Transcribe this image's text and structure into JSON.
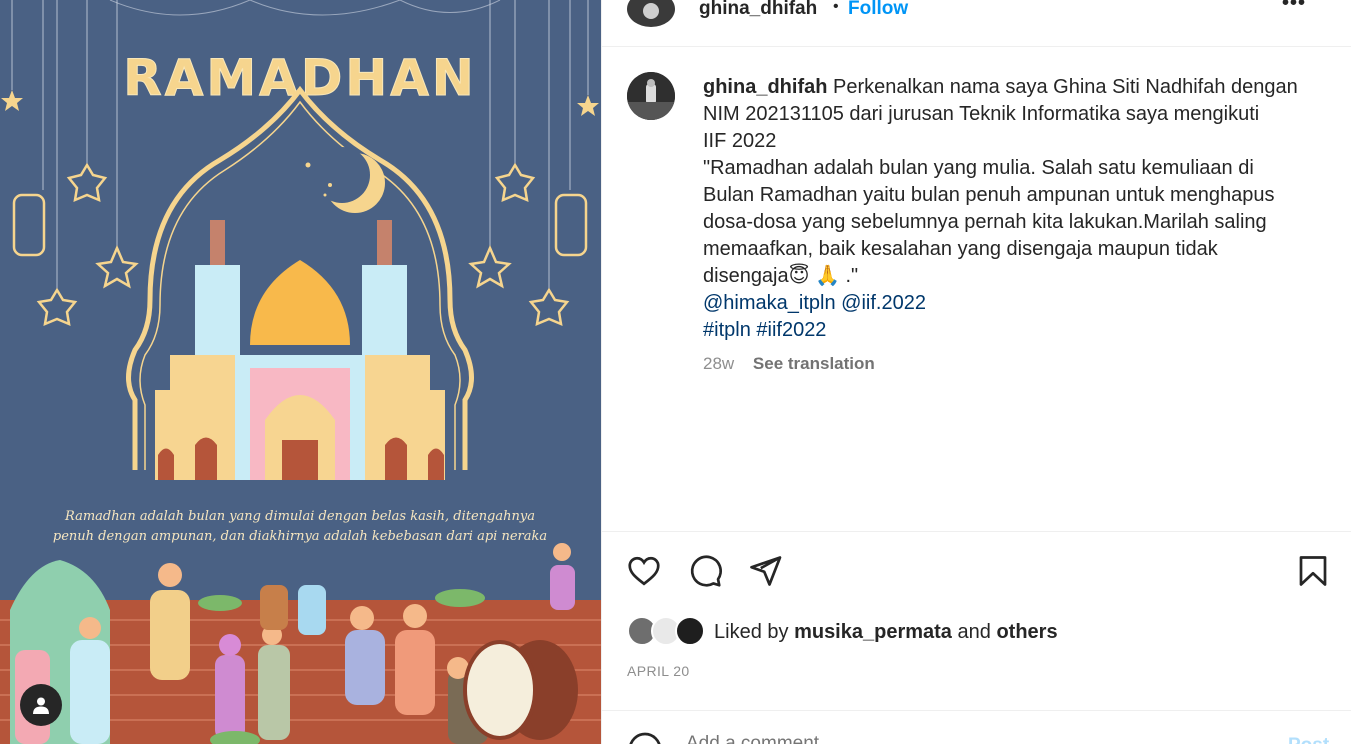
{
  "post": {
    "username": "ghina_dhifah",
    "follow_label": "Follow",
    "separator": "•",
    "more_label": "•••",
    "caption": {
      "line1": "Perkenalkan nama saya Ghina Siti Nadhifah dengan",
      "line2": "NIM 202131105 dari jurusan Teknik Informatika saya mengikuti",
      "line3": "IIF 2022",
      "line4": "\"Ramadhan adalah bulan yang mulia. Salah satu kemuliaan di",
      "line5": "Bulan Ramadhan yaitu bulan penuh ampunan untuk menghapus",
      "line6": "dosa-dosa yang sebelumnya pernah kita lakukan.Marilah saling",
      "line7": "memaafkan, baik kesalahan yang disengaja maupun tidak",
      "line8": "disengaja😇 🙏 .\"",
      "mention1": "@himaka_itpln",
      "mention2": "@iif.2022",
      "hashtag1": "#itpln",
      "hashtag2": "#iif2022"
    },
    "age": "28w",
    "see_translation": "See translation",
    "liked_prefix": "Liked by",
    "liked_user": "musika_permata",
    "liked_and": "and",
    "liked_others": "others",
    "date": "APRIL 20",
    "comment_placeholder": "Add a comment...",
    "post_button": "Post"
  },
  "image": {
    "title": "RAMADHAN",
    "quote_line1": "Ramadhan adalah bulan yang dimulai dengan belas kasih, ditengahnya",
    "quote_line2": "penuh dengan ampunan, dan diakhirnya adalah kebebasan dari api neraka",
    "colors": {
      "background": "#4a6184",
      "glow": "#f6d58e",
      "wall": "#b5553a",
      "dome": "#f8b94b"
    }
  },
  "colors": {
    "link": "#00376b",
    "follow": "#0095f6",
    "muted": "#8e8e8e"
  }
}
